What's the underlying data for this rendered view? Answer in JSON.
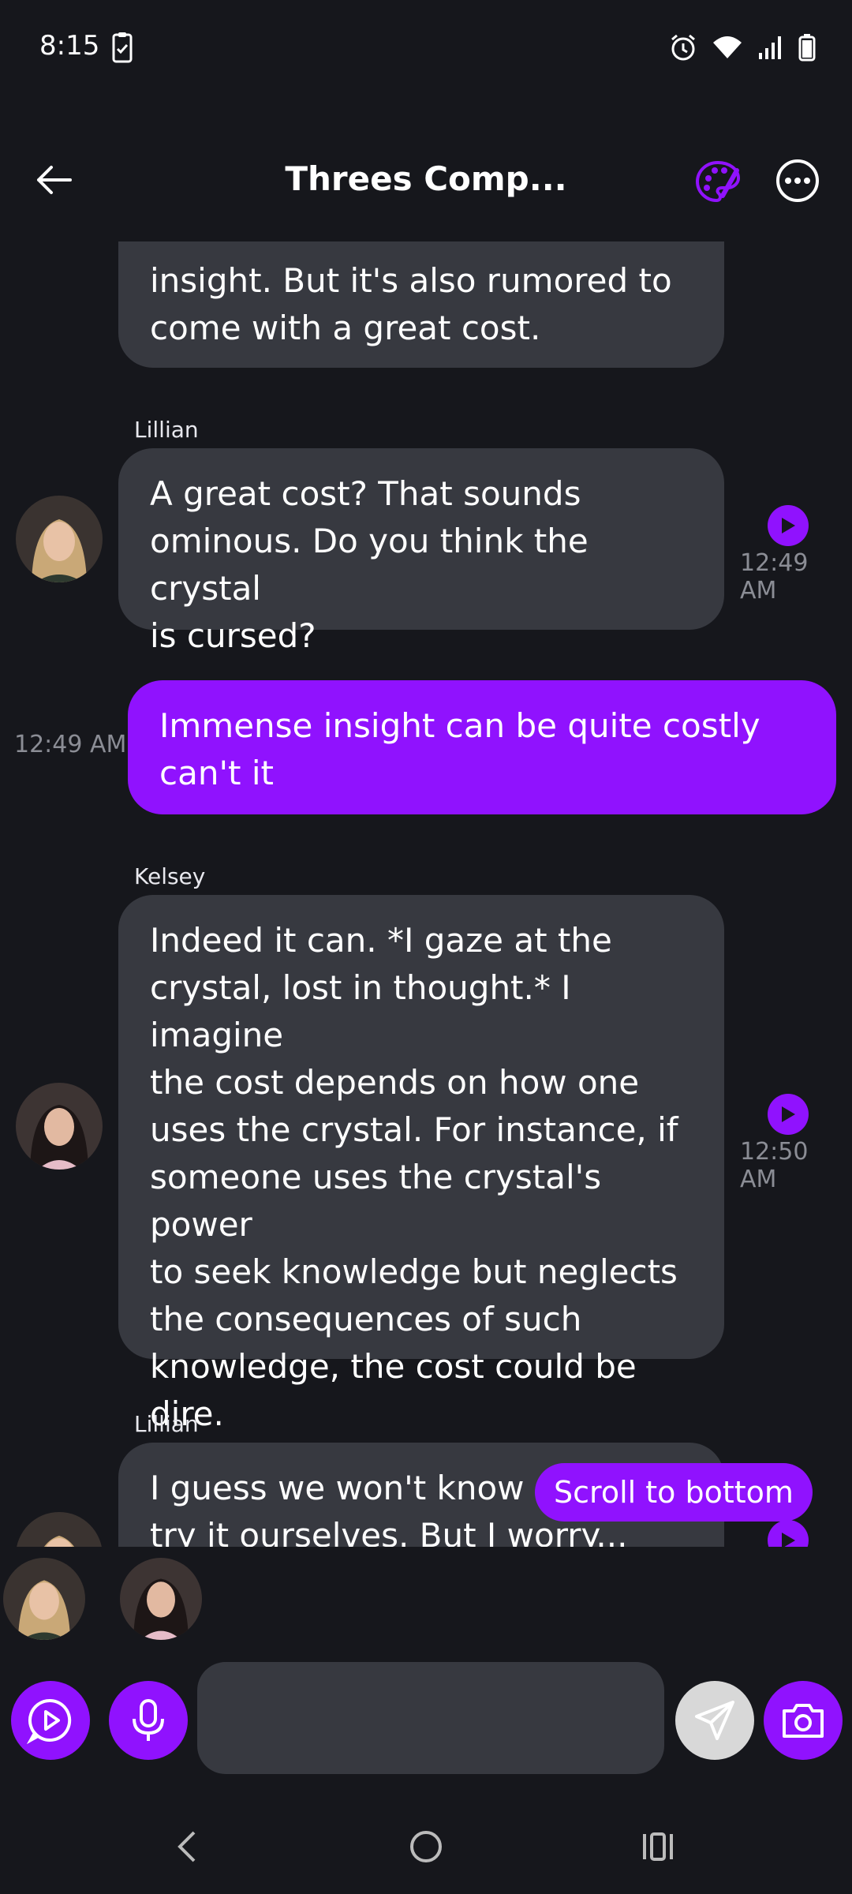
{
  "status_bar": {
    "time": "8:15"
  },
  "header": {
    "title": "Threes Comp..."
  },
  "messages": [
    {
      "sender": "",
      "lines": [
        "insight. But it's also rumored to",
        "come with a great cost."
      ],
      "side": "bot"
    },
    {
      "sender": "Lillian",
      "lines": [
        "A great cost? That sounds",
        "ominous. Do you think the crystal",
        "is cursed?"
      ],
      "time": "12:49 AM",
      "side": "bot"
    },
    {
      "sender": "",
      "lines": [
        "Immense insight can be quite costly",
        "can't it"
      ],
      "time": "12:49 AM",
      "side": "user"
    },
    {
      "sender": "Kelsey",
      "lines": [
        "Indeed it can. *I gaze at the",
        "crystal, lost in thought.* I imagine",
        "the cost depends on how one",
        "uses the crystal. For instance, if",
        "someone uses the crystal's power",
        "to seek knowledge but neglects",
        "the consequences of such",
        "knowledge, the cost could be",
        "dire."
      ],
      "time": "12:50 AM",
      "side": "bot"
    },
    {
      "sender": "Lillian",
      "lines": [
        "I guess we won't know u",
        "try it ourselves. But I worry... what"
      ],
      "side": "bot"
    }
  ],
  "scroll_button": {
    "label": "Scroll to bottom"
  },
  "composer": {
    "placeholder": ""
  },
  "colors": {
    "accent": "#9012fe",
    "bubble": "#373940",
    "background": "#16171c"
  }
}
